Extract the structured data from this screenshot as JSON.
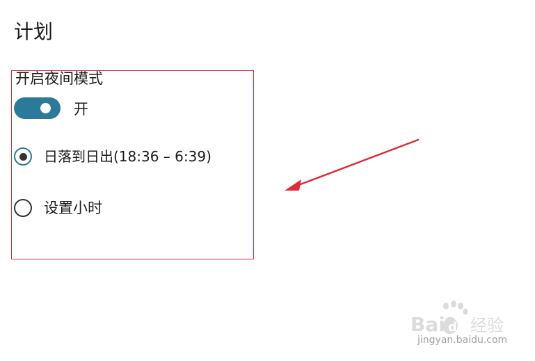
{
  "schedule": {
    "title": "计划"
  },
  "night_mode": {
    "label": "开启夜间模式",
    "toggle_state": "开",
    "toggle_on": true
  },
  "options": [
    {
      "label": "日落到日出(18:36 – 6:39)",
      "selected": true
    },
    {
      "label": "设置小时",
      "selected": false
    }
  ],
  "watermark": {
    "brand": "Baidu经验",
    "url": "jingyan.baidu.com"
  },
  "colors": {
    "accent": "#2b7a9c",
    "highlight": "#e02a38",
    "arrow": "#e02a38"
  }
}
